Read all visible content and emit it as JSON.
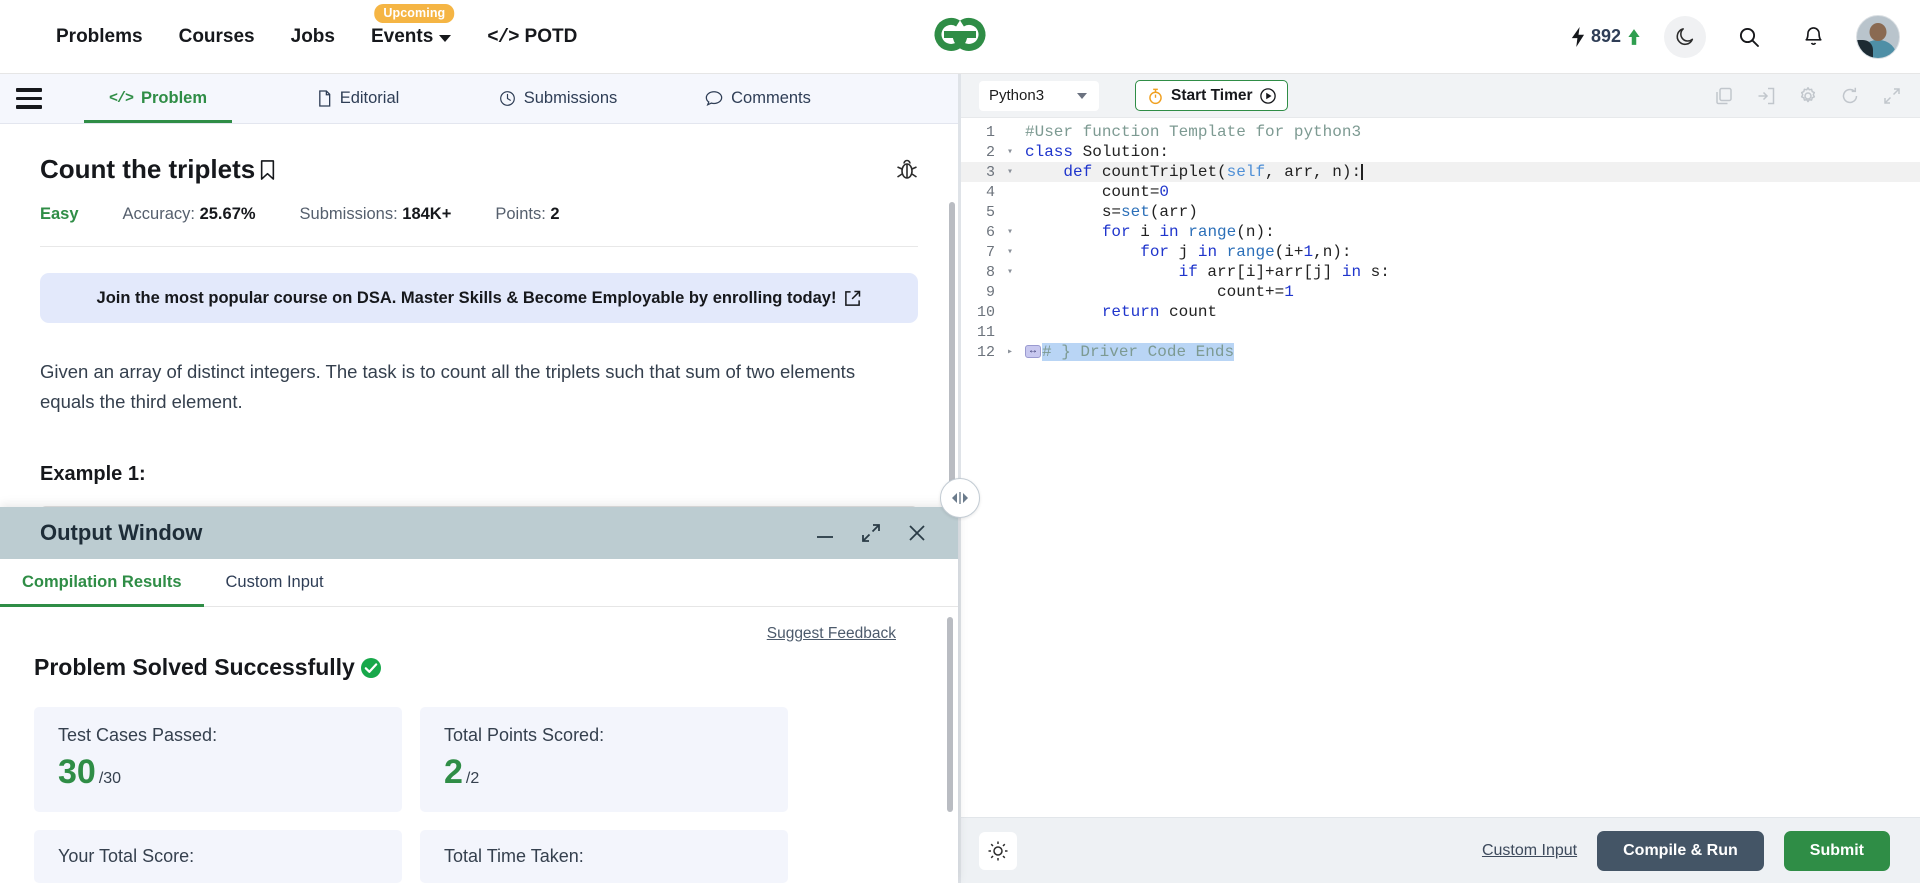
{
  "nav": {
    "items": [
      {
        "label": "Problems",
        "icon": "",
        "badge": ""
      },
      {
        "label": "Courses",
        "icon": "",
        "badge": ""
      },
      {
        "label": "Jobs",
        "icon": "",
        "badge": ""
      },
      {
        "label": "Events",
        "icon": "chevron-down-icon",
        "badge": "Upcoming"
      },
      {
        "label": "POTD",
        "icon": "code-icon",
        "badge": ""
      }
    ],
    "logo_alt": "geeksforgeeks-logo",
    "score": "892",
    "score_icon": "lightning-bolt-icon",
    "score_trend_icon": "arrow-up-icon",
    "darkmode_icon": "moon-icon",
    "search_icon": "search-icon",
    "notification_icon": "bell-icon",
    "avatar_icon": "user-avatar"
  },
  "left": {
    "menu_icon": "hamburger-menu-icon",
    "tabs": [
      {
        "label": "Problem",
        "icon": "code-icon",
        "active": true
      },
      {
        "label": "Editorial",
        "icon": "document-icon",
        "active": false
      },
      {
        "label": "Submissions",
        "icon": "clock-icon",
        "active": false
      },
      {
        "label": "Comments",
        "icon": "comment-icon",
        "active": false
      }
    ],
    "title": "Count the triplets",
    "bookmark_icon": "bookmark-icon",
    "report_icon": "bug-report-icon",
    "meta": {
      "difficulty": "Easy",
      "accuracy_label": "Accuracy:",
      "accuracy_value": "25.67%",
      "submissions_label": "Submissions:",
      "submissions_value": "184K+",
      "points_label": "Points:",
      "points_value": "2"
    },
    "promo": {
      "text": "Join the most popular course on DSA. Master Skills & Become Employable by enrolling today!",
      "icon": "external-link-icon"
    },
    "statement": "Given an array of distinct integers. The task is to count all the triplets such that sum of two elements equals the third element.",
    "example_heading": "Example 1:"
  },
  "output_window": {
    "title": "Output Window",
    "minimize_icon": "minimize-icon",
    "expand_icon": "expand-icon",
    "close_icon": "close-icon",
    "tabs": [
      {
        "label": "Compilation Results",
        "active": true
      },
      {
        "label": "Custom Input",
        "active": false
      }
    ],
    "suggest_feedback": "Suggest Feedback",
    "status_text": "Problem Solved Successfully",
    "status_icon": "check-circle-icon",
    "cards": [
      {
        "label": "Test Cases Passed:",
        "value": "30",
        "denom": "/30"
      },
      {
        "label": "Total Points Scored:",
        "value": "2",
        "denom": "/2"
      },
      {
        "label": "Your Total Score:",
        "value": "",
        "denom": ""
      },
      {
        "label": "Total Time Taken:",
        "value": "",
        "denom": ""
      }
    ]
  },
  "splitter": {
    "icon": "resize-horizontal-icon"
  },
  "editor": {
    "language": "Python3",
    "language_caret_icon": "chevron-down-icon",
    "timer_label": "Start Timer",
    "timer_icon": "stopwatch-icon",
    "timer_play_icon": "play-circle-icon",
    "tools": [
      {
        "name": "copy-code-icon"
      },
      {
        "name": "import-code-icon"
      },
      {
        "name": "editor-settings-icon"
      },
      {
        "name": "reset-code-icon"
      },
      {
        "name": "fullscreen-icon"
      }
    ],
    "code_lines": [
      {
        "n": "1",
        "fold": "",
        "highlight": false,
        "tokens": [
          {
            "t": "#User function Template for python3",
            "c": "tok-comment"
          }
        ]
      },
      {
        "n": "2",
        "fold": "▾",
        "highlight": false,
        "tokens": [
          {
            "t": "class",
            "c": "tok-kw"
          },
          {
            "t": " Solution:",
            "c": "tok-plain"
          }
        ]
      },
      {
        "n": "3",
        "fold": "▾",
        "highlight": true,
        "tokens": [
          {
            "t": "    ",
            "c": "tok-plain"
          },
          {
            "t": "def",
            "c": "tok-kw"
          },
          {
            "t": " countTriplet(",
            "c": "tok-plain"
          },
          {
            "t": "self",
            "c": "tok-self"
          },
          {
            "t": ", arr, n):",
            "c": "tok-plain"
          }
        ]
      },
      {
        "n": "4",
        "fold": "",
        "highlight": false,
        "tokens": [
          {
            "t": "        count=",
            "c": "tok-plain"
          },
          {
            "t": "0",
            "c": "tok-num"
          }
        ]
      },
      {
        "n": "5",
        "fold": "",
        "highlight": false,
        "tokens": [
          {
            "t": "        s=",
            "c": "tok-plain"
          },
          {
            "t": "set",
            "c": "tok-builtin"
          },
          {
            "t": "(arr)",
            "c": "tok-plain"
          }
        ]
      },
      {
        "n": "6",
        "fold": "▾",
        "highlight": false,
        "tokens": [
          {
            "t": "        ",
            "c": "tok-plain"
          },
          {
            "t": "for",
            "c": "tok-kw"
          },
          {
            "t": " i ",
            "c": "tok-plain"
          },
          {
            "t": "in",
            "c": "tok-kw"
          },
          {
            "t": " ",
            "c": "tok-plain"
          },
          {
            "t": "range",
            "c": "tok-builtin"
          },
          {
            "t": "(n):",
            "c": "tok-plain"
          }
        ]
      },
      {
        "n": "7",
        "fold": "▾",
        "highlight": false,
        "tokens": [
          {
            "t": "            ",
            "c": "tok-plain"
          },
          {
            "t": "for",
            "c": "tok-kw"
          },
          {
            "t": " j ",
            "c": "tok-plain"
          },
          {
            "t": "in",
            "c": "tok-kw"
          },
          {
            "t": " ",
            "c": "tok-plain"
          },
          {
            "t": "range",
            "c": "tok-builtin"
          },
          {
            "t": "(i+",
            "c": "tok-plain"
          },
          {
            "t": "1",
            "c": "tok-num"
          },
          {
            "t": ",n):",
            "c": "tok-plain"
          }
        ]
      },
      {
        "n": "8",
        "fold": "▾",
        "highlight": false,
        "tokens": [
          {
            "t": "                ",
            "c": "tok-plain"
          },
          {
            "t": "if",
            "c": "tok-kw"
          },
          {
            "t": " arr[i]+arr[j] ",
            "c": "tok-plain"
          },
          {
            "t": "in",
            "c": "tok-kw"
          },
          {
            "t": " s:",
            "c": "tok-plain"
          }
        ]
      },
      {
        "n": "9",
        "fold": "",
        "highlight": false,
        "tokens": [
          {
            "t": "                    count+=",
            "c": "tok-plain"
          },
          {
            "t": "1",
            "c": "tok-num"
          }
        ]
      },
      {
        "n": "10",
        "fold": "",
        "highlight": false,
        "tokens": [
          {
            "t": "        ",
            "c": "tok-plain"
          },
          {
            "t": "return",
            "c": "tok-kw"
          },
          {
            "t": " count",
            "c": "tok-plain"
          }
        ]
      },
      {
        "n": "11",
        "fold": "",
        "highlight": false,
        "tokens": []
      },
      {
        "n": "12",
        "fold": "▸",
        "highlight": false,
        "widget": "↔",
        "tokens": [
          {
            "t": "# } Driver Code Ends",
            "c": "tok-comment sel-hl"
          }
        ]
      }
    ],
    "bulb_icon": "hint-bulb-icon",
    "custom_input_link": "Custom Input",
    "compile_label": "Compile & Run",
    "submit_label": "Submit"
  }
}
